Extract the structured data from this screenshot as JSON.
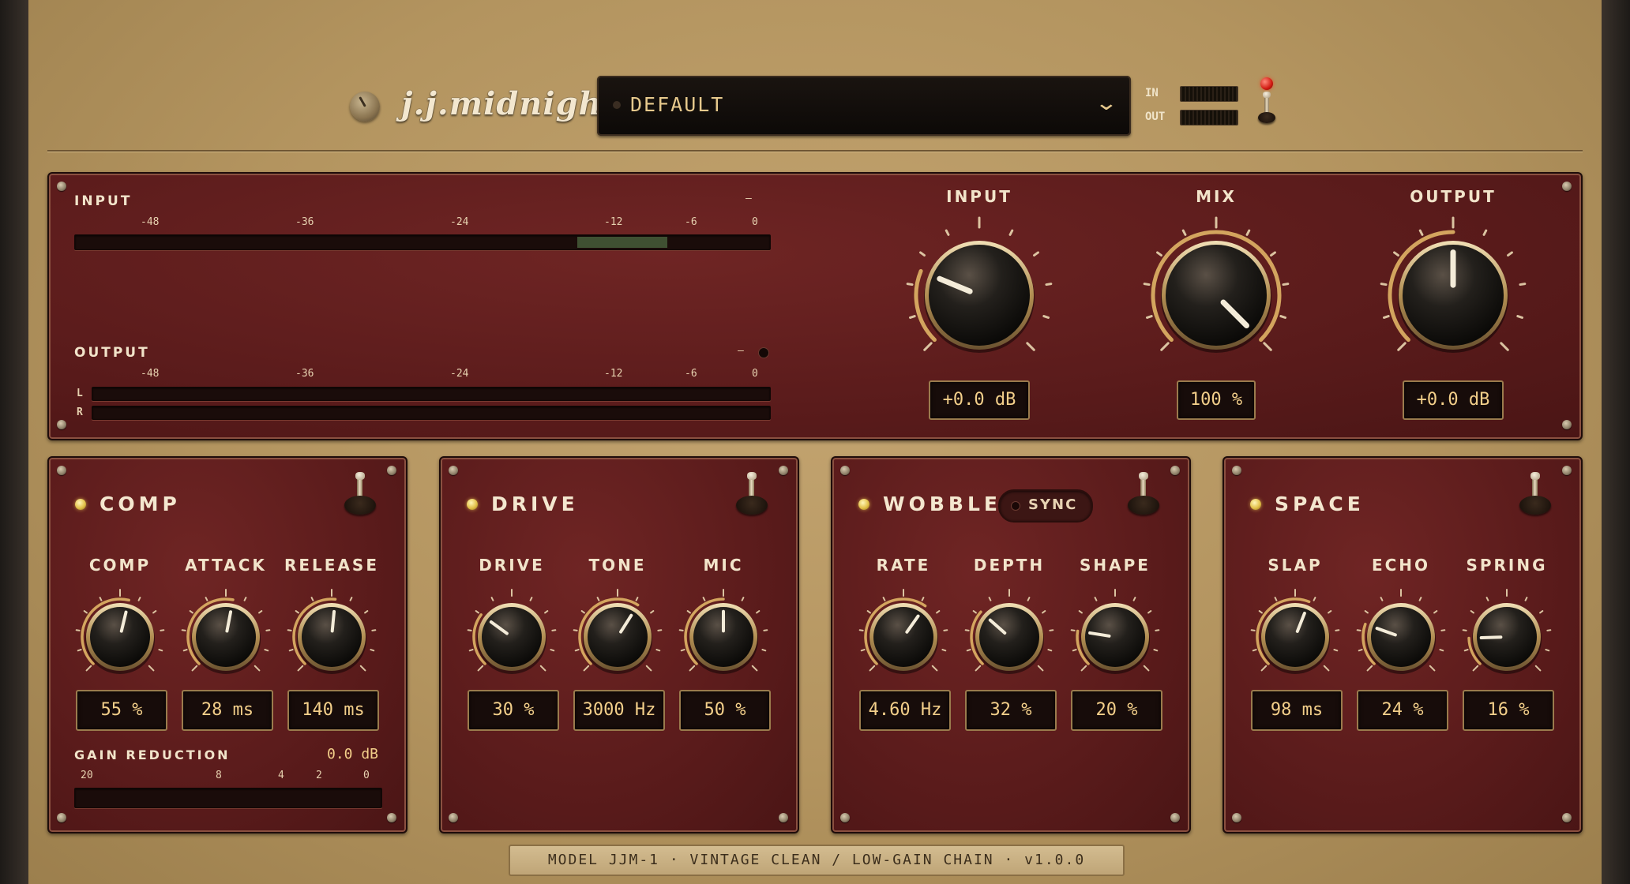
{
  "brand": {
    "name": "j.j.midnight"
  },
  "preset": {
    "name": "DEFAULT"
  },
  "header": {
    "in_label": "IN",
    "out_label": "OUT"
  },
  "meters": {
    "input_label": "INPUT",
    "output_label": "OUTPUT",
    "scale": [
      "-48",
      "-36",
      "-24",
      "-12",
      "-6",
      "0"
    ],
    "input_peak": "—",
    "output_peak": "—",
    "channel_l": "L",
    "channel_r": "R"
  },
  "master": {
    "input": {
      "label": "INPUT",
      "value": "+0.0 dB",
      "norm": 0.25
    },
    "mix": {
      "label": "MIX",
      "value": "100 %",
      "norm": 1.0
    },
    "output": {
      "label": "OUTPUT",
      "value": "+0.0 dB",
      "norm": 0.5
    }
  },
  "sections": {
    "comp": {
      "title": "COMP",
      "knobs": [
        {
          "label": "COMP",
          "value": "55 %",
          "norm": 0.55
        },
        {
          "label": "ATTACK",
          "value": "28 ms",
          "norm": 0.54
        },
        {
          "label": "RELEASE",
          "value": "140 ms",
          "norm": 0.52
        }
      ],
      "gr_label": "GAIN REDUCTION",
      "gr_value": "0.0 dB",
      "gr_scale": [
        "20",
        "8",
        "4",
        "2",
        "0"
      ]
    },
    "drive": {
      "title": "DRIVE",
      "knobs": [
        {
          "label": "DRIVE",
          "value": "30 %",
          "norm": 0.3
        },
        {
          "label": "TONE",
          "value": "3000 Hz",
          "norm": 0.62
        },
        {
          "label": "MIC",
          "value": "50 %",
          "norm": 0.5
        }
      ]
    },
    "wobble": {
      "title": "WOBBLE",
      "sync_label": "SYNC",
      "knobs": [
        {
          "label": "RATE",
          "value": "4.60 Hz",
          "norm": 0.63
        },
        {
          "label": "DEPTH",
          "value": "32 %",
          "norm": 0.32
        },
        {
          "label": "SHAPE",
          "value": "20 %",
          "norm": 0.2
        }
      ]
    },
    "space": {
      "title": "SPACE",
      "knobs": [
        {
          "label": "SLAP",
          "value": "98 ms",
          "norm": 0.58
        },
        {
          "label": "ECHO",
          "value": "24 %",
          "norm": 0.24
        },
        {
          "label": "SPRING",
          "value": "16 %",
          "norm": 0.16
        }
      ]
    }
  },
  "footer": {
    "text": "MODEL JJM-1  ·  VINTAGE CLEAN / LOW-GAIN CHAIN  ·  v1.0.0"
  },
  "colors": {
    "panel": "#5a1b1b",
    "chassis": "#b3945f",
    "readout_text": "#f3cf8a",
    "arc": "#e0b466"
  }
}
